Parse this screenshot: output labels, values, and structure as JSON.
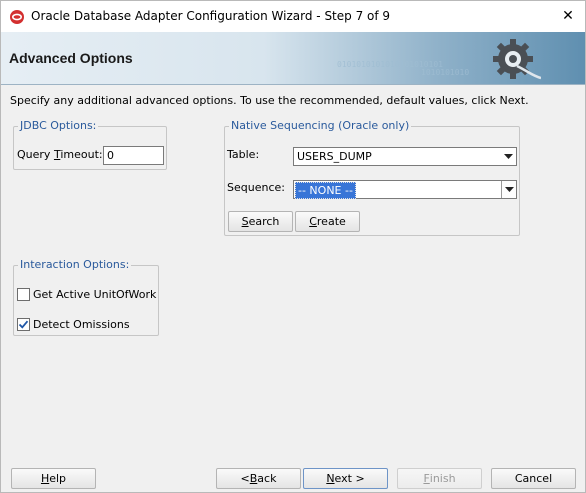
{
  "window": {
    "title": "Oracle Database Adapter Configuration Wizard - Step 7 of 9",
    "close_symbol": "✕"
  },
  "banner": {
    "title": "Advanced Options",
    "binary_line1": "0101010101010101010101",
    "binary_line2": "1010101010"
  },
  "instruction": "Specify any additional advanced options.  To use the recommended, default values, click Next.",
  "jdbc": {
    "legend": "JDBC Options:",
    "query_timeout_label_pre": "Query ",
    "query_timeout_label_mn": "T",
    "query_timeout_label_post": "imeout:",
    "query_timeout_value": "0"
  },
  "native_sequencing": {
    "legend": "Native Sequencing (Oracle only)",
    "table_label": "Table:",
    "table_value": "USERS_DUMP",
    "sequence_label": "Sequence:",
    "sequence_value": "-- NONE --",
    "search_mn": "S",
    "search_rest": "earch",
    "create_mn": "C",
    "create_rest": "reate"
  },
  "interaction": {
    "legend": "Interaction Options:",
    "get_active_label": "Get Active UnitOfWork",
    "get_active_checked": false,
    "detect_omissions_label": "Detect Omissions",
    "detect_omissions_checked": true
  },
  "footer": {
    "help_mn": "H",
    "help_rest": "elp",
    "back_pre": "< ",
    "back_mn": "B",
    "back_rest": "ack",
    "next_mn": "N",
    "next_rest": "ext >",
    "finish_mn": "F",
    "finish_rest": "inish",
    "cancel_label": "Cancel"
  },
  "colors": {
    "legend": "#2a5a9c",
    "selection": "#3875d7",
    "banner_dark": "#5f8fb0"
  },
  "icons": [
    "oracle-app-icon",
    "close-icon",
    "gear-plug-icon",
    "chevron-down-icon",
    "checkmark-icon"
  ]
}
